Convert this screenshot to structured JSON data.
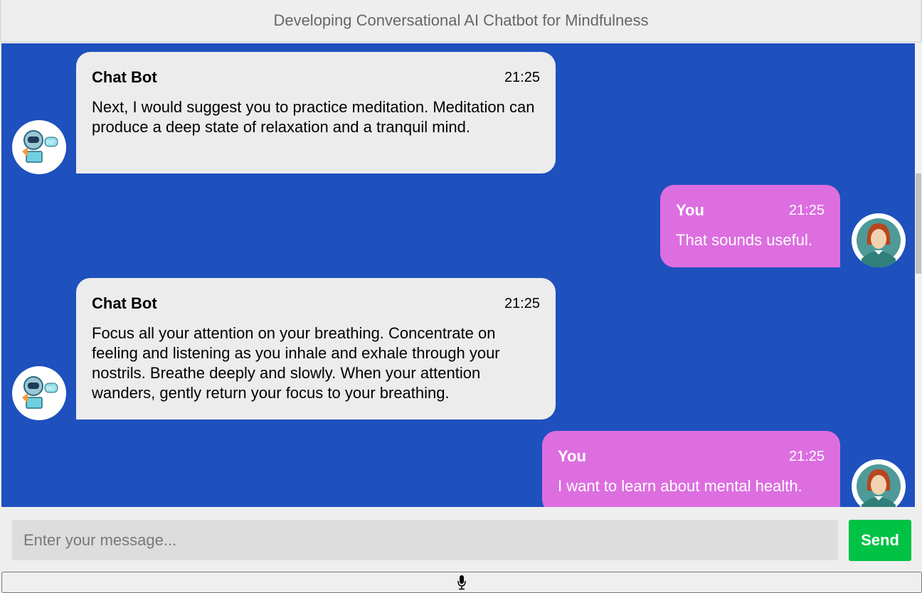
{
  "header": {
    "title": "Developing Conversational AI Chatbot for Mindfulness"
  },
  "messages": [
    {
      "sender": "Chat Bot",
      "time": "21:25",
      "text": "Next, I would suggest you to practice meditation. Meditation can produce a deep state of relaxation and a tranquil mind.",
      "side": "left"
    },
    {
      "sender": "You",
      "time": "21:25",
      "text": "That sounds useful.",
      "side": "right"
    },
    {
      "sender": "Chat Bot",
      "time": "21:25",
      "text": "Focus all your attention on your breathing. Concentrate on feeling and listening as you inhale and exhale through your nostrils. Breathe deeply and slowly. When your attention wanders, gently return your focus to your breathing.",
      "side": "left"
    },
    {
      "sender": "You",
      "time": "21:25",
      "text": "I want to learn about mental health.",
      "side": "right"
    }
  ],
  "composer": {
    "placeholder": "Enter your message...",
    "value": "",
    "send_label": "Send",
    "mic_icon": "microphone-icon"
  },
  "colors": {
    "chat_bg": "#1e50be",
    "bot_bubble": "#ececec",
    "user_bubble": "#dd6ee0",
    "send": "#00c244"
  }
}
